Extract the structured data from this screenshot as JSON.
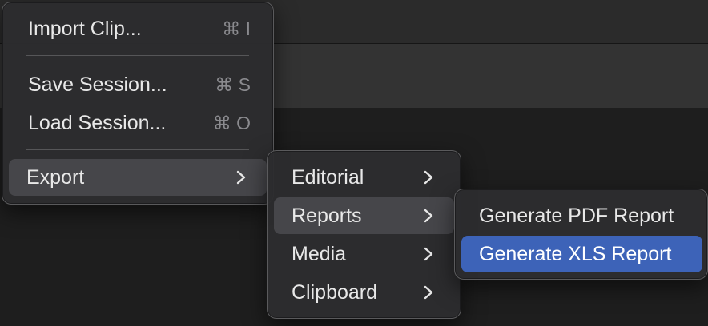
{
  "main_menu": {
    "items": [
      {
        "label": "Import Clip...",
        "shortcut": "⌘ I"
      },
      {
        "label": "Save Session...",
        "shortcut": "⌘ S"
      },
      {
        "label": "Load Session...",
        "shortcut": "⌘ O"
      },
      {
        "label": "Export"
      }
    ]
  },
  "export_menu": {
    "items": [
      {
        "label": "Editorial"
      },
      {
        "label": "Reports"
      },
      {
        "label": "Media"
      },
      {
        "label": "Clipboard"
      }
    ]
  },
  "reports_menu": {
    "items": [
      {
        "label": "Generate PDF Report"
      },
      {
        "label": "Generate XLS Report"
      }
    ]
  },
  "colors": {
    "highlight": "#3d63b8",
    "hover": "#46464a",
    "menu_bg": "#2c2c2e"
  }
}
